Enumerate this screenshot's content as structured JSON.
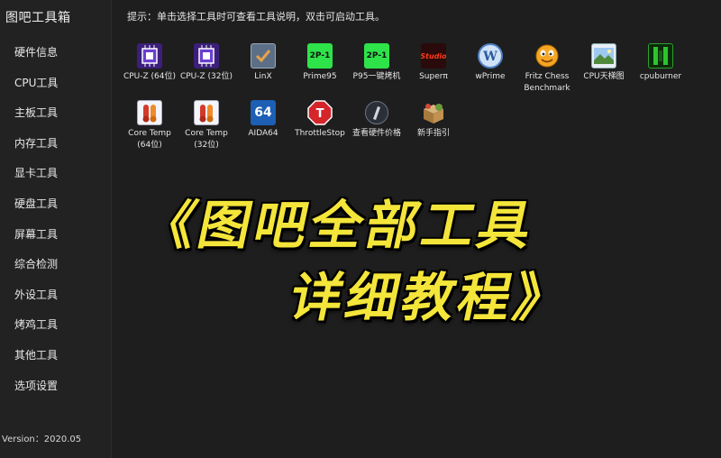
{
  "app": {
    "title": "图吧工具箱",
    "version": "Version：2020.05"
  },
  "sidebar": {
    "items": [
      {
        "label": "硬件信息"
      },
      {
        "label": "CPU工具"
      },
      {
        "label": "主板工具"
      },
      {
        "label": "内存工具"
      },
      {
        "label": "显卡工具"
      },
      {
        "label": "硬盘工具"
      },
      {
        "label": "屏幕工具"
      },
      {
        "label": "综合检测"
      },
      {
        "label": "外设工具"
      },
      {
        "label": "烤鸡工具"
      },
      {
        "label": "其他工具"
      },
      {
        "label": "选项设置"
      }
    ]
  },
  "main": {
    "hint": "提示：单击选择工具时可查看工具说明，双击可启动工具。",
    "tools": [
      {
        "label": "CPU-Z (64位)",
        "icon": "cpu-z-icon"
      },
      {
        "label": "CPU-Z (32位)",
        "icon": "cpu-z-icon"
      },
      {
        "label": "LinX",
        "icon": "linx-icon"
      },
      {
        "label": "Prime95",
        "icon": "prime95-icon"
      },
      {
        "label": "P95一键烤机",
        "icon": "prime95-icon"
      },
      {
        "label": "Superπ",
        "icon": "superpi-icon"
      },
      {
        "label": "wPrime",
        "icon": "wprime-icon"
      },
      {
        "label": "Fritz Chess\nBenchmark",
        "icon": "fritz-chess-icon"
      },
      {
        "label": "CPU天梯图",
        "icon": "cpu-ladder-icon"
      },
      {
        "label": "cpuburner",
        "icon": "cpuburner-icon"
      },
      {
        "label": "Core Temp\n(64位)",
        "icon": "thermometer-icon"
      },
      {
        "label": "Core Temp\n(32位)",
        "icon": "thermometer-icon"
      },
      {
        "label": "AIDA64",
        "icon": "aida64-icon"
      },
      {
        "label": "ThrottleStop",
        "icon": "throttlestop-icon"
      },
      {
        "label": "查看硬件价格",
        "icon": "price-check-icon"
      },
      {
        "label": "新手指引",
        "icon": "guide-box-icon"
      }
    ],
    "icon_text": {
      "aida": "64",
      "throttle": "T",
      "prime": "2P-1",
      "superpi": "Studio"
    }
  },
  "banner": {
    "line1": "《图吧全部工具",
    "line2": "详细教程》"
  },
  "colors": {
    "banner_text": "#f4e53a",
    "background": "#1e1e1e",
    "sidebar": "#222222"
  }
}
